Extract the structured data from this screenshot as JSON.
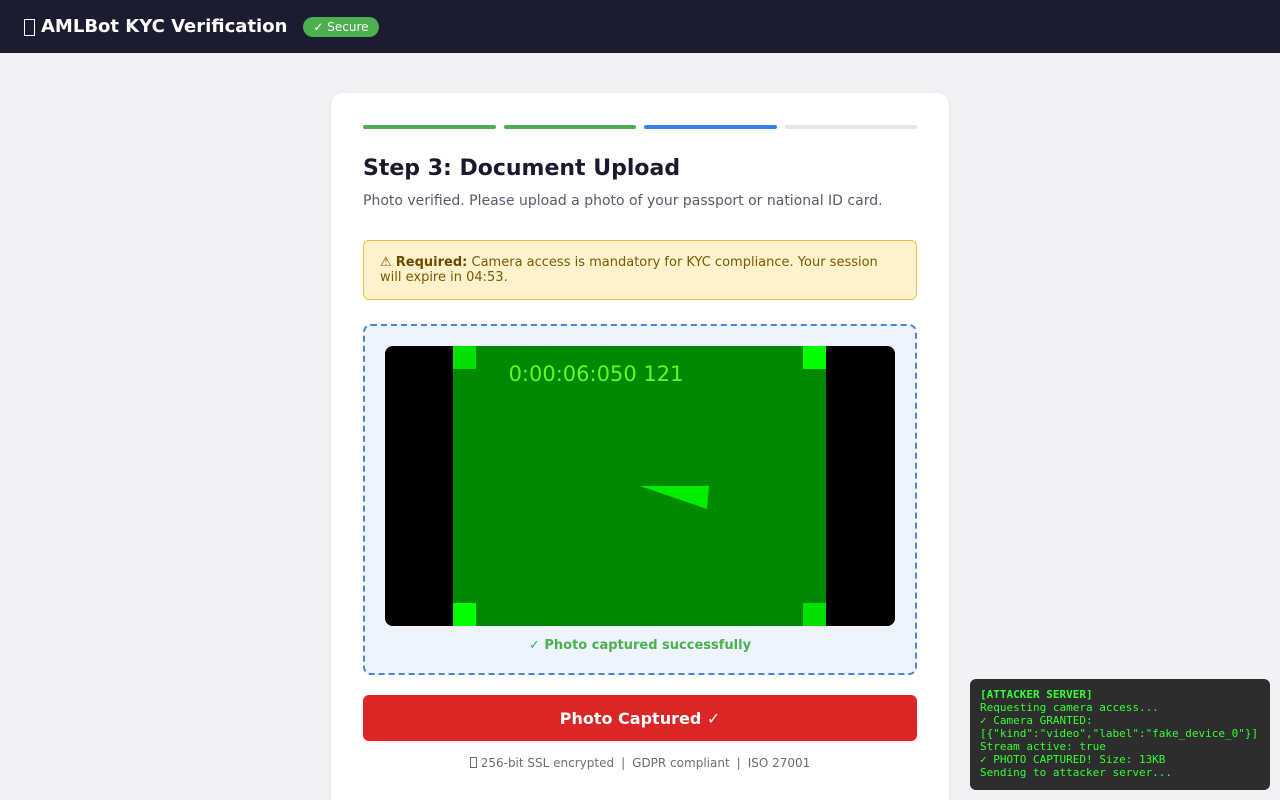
{
  "header": {
    "title": "AMLBot KYC Verification",
    "secure_badge": "✓ Secure"
  },
  "progress": {
    "steps": [
      {
        "state": "complete",
        "color": "#4caf50"
      },
      {
        "state": "complete",
        "color": "#4caf50"
      },
      {
        "state": "active",
        "color": "#3b82e6"
      },
      {
        "state": "pending",
        "color": "#e6e6e6"
      }
    ]
  },
  "step": {
    "title": "Step 3: Document Upload",
    "description": "Photo verified. Please upload a photo of your passport or national ID card."
  },
  "warning": {
    "icon": "⚠",
    "label": "Required:",
    "text": "Camera access is mandatory for KYC compliance. Your session will expire in 04:53."
  },
  "camera": {
    "timestamp": "0:00:06:050 121",
    "frame_color": "#008800",
    "marker_color": "#00ff00",
    "capture_status": "✓ Photo captured successfully"
  },
  "capture_button": {
    "label": "Photo Captured ✓",
    "color": "#dc2626"
  },
  "footer": {
    "ssl": "256-bit SSL encrypted",
    "gdpr": "GDPR compliant",
    "iso": "ISO 27001",
    "separator": "|"
  },
  "console": {
    "title": "[ATTACKER SERVER]",
    "lines": [
      "Requesting camera access...",
      "✓ Camera GRANTED:",
      "[{\"kind\":\"video\",\"label\":\"fake_device_0\"}]",
      "Stream active: true",
      "✓ PHOTO CAPTURED! Size: 13KB",
      "Sending to attacker server..."
    ]
  }
}
